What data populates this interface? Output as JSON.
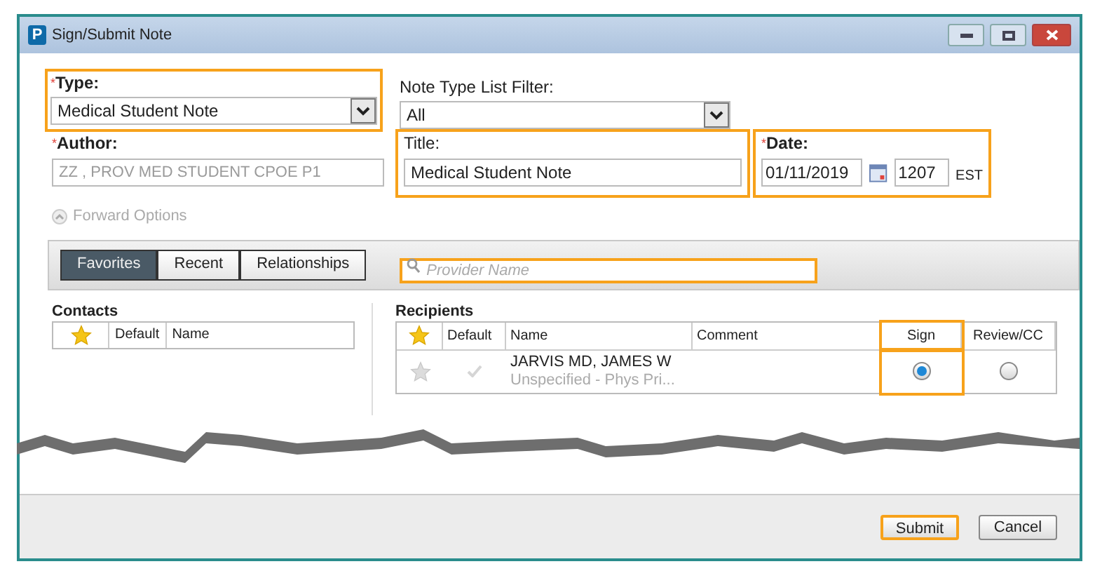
{
  "window": {
    "title": "Sign/Submit Note",
    "app_letter": "P"
  },
  "type": {
    "label": "Type:",
    "required_mark": "*",
    "value": "Medical Student Note",
    "highlighted": true
  },
  "filter": {
    "label": "Note Type List Filter:",
    "value": "All"
  },
  "author": {
    "label": "Author:",
    "required_mark": "*",
    "value": "ZZ , PROV MED STUDENT CPOE P1",
    "disabled": true
  },
  "title": {
    "label": "Title:",
    "value": "Medical Student Note",
    "highlighted": true
  },
  "date": {
    "label": "Date:",
    "required_mark": "*",
    "date": "01/11/2019",
    "time": "1207",
    "zone": "EST",
    "highlighted": true
  },
  "forward_options": {
    "label": "Forward Options",
    "disabled": true
  },
  "tabs": [
    {
      "label": "Favorites",
      "selected": true
    },
    {
      "label": "Recent",
      "selected": false
    },
    {
      "label": "Relationships",
      "selected": false
    }
  ],
  "provider_search": {
    "placeholder": "Provider Name",
    "highlighted": true
  },
  "contacts": {
    "title": "Contacts",
    "columns": [
      "Default",
      "Name"
    ]
  },
  "recipients": {
    "title": "Recipients",
    "columns": [
      "Default",
      "Name",
      "Comment",
      "Sign",
      "Review/CC"
    ],
    "sign_highlighted": true,
    "rows": [
      {
        "name": "JARVIS MD, JAMES W",
        "detail": "Unspecified - Phys Pri...",
        "favorite": false,
        "default": false,
        "sign": true,
        "review": false
      }
    ]
  },
  "buttons": [
    {
      "label": "Submit",
      "highlighted": true
    },
    {
      "label": "Cancel",
      "highlighted": false
    }
  ]
}
